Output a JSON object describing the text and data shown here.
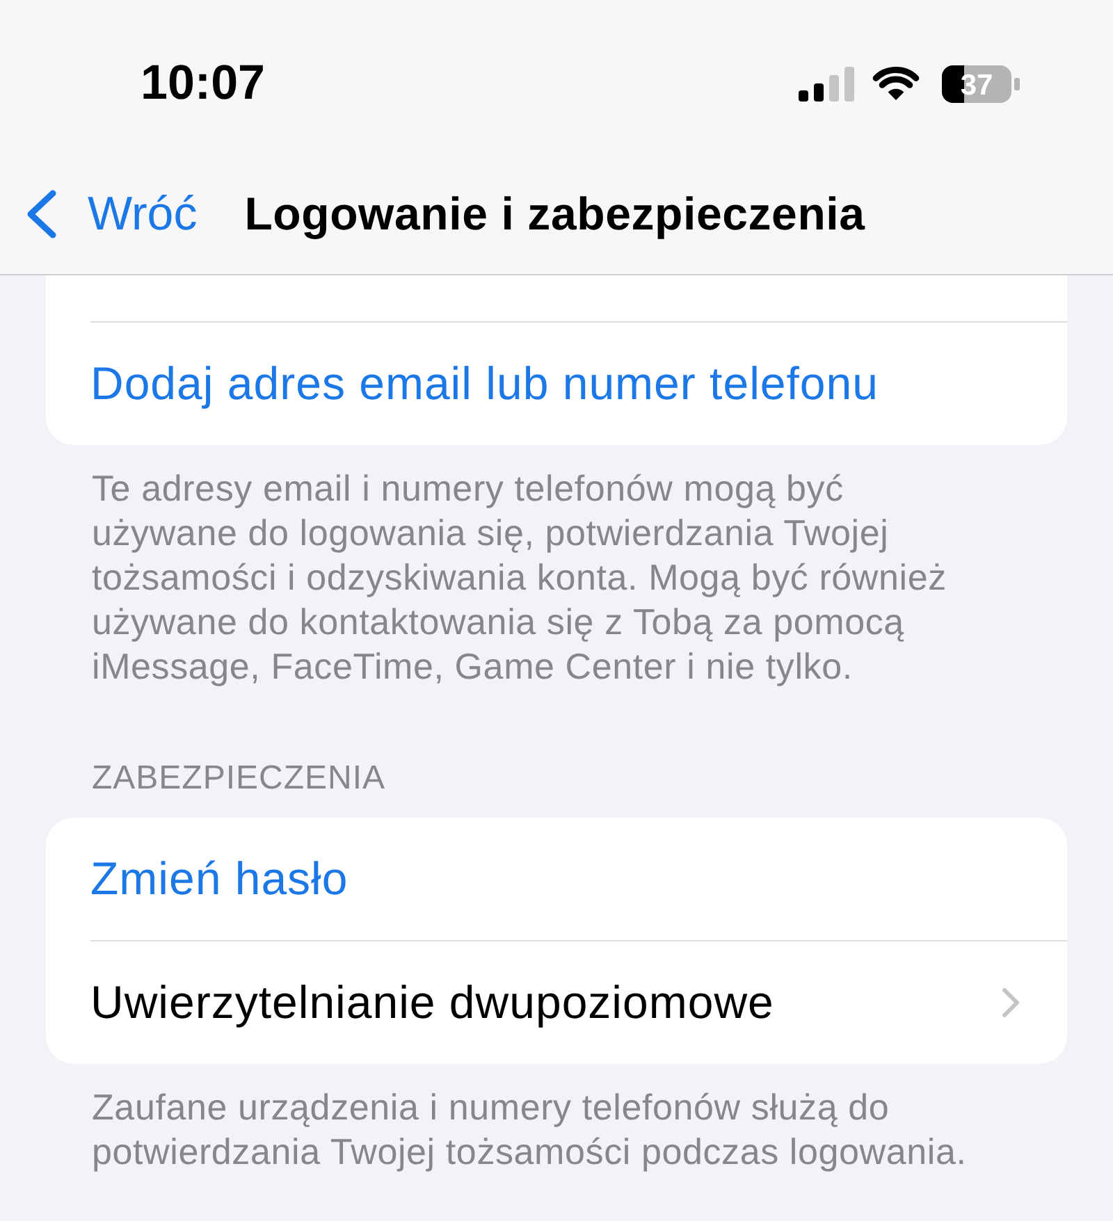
{
  "status_bar": {
    "time": "10:07",
    "battery": "37"
  },
  "nav_bar": {
    "back_label": "Wróć",
    "title": "Logowanie i zabezpieczenia"
  },
  "sections": [
    {
      "clipped": true,
      "rows": [
        {
          "kind": "action",
          "label": "Dodaj adres email lub numer telefonu"
        }
      ],
      "footer": "Te adresy email i numery telefonów mogą być używane do logowania się, potwierdzania Twojej tożsamości i odzyskiwania konta. Mogą być również używane do kontaktowania się z Tobą za pomocą iMessage, FaceTime, Game Center i nie tylko."
    },
    {
      "header": "ZABEZPIECZENIA",
      "clipped": false,
      "rows": [
        {
          "kind": "action",
          "label": "Zmień hasło"
        },
        {
          "kind": "link",
          "label": "Uwierzytelnianie dwupoziomowe"
        }
      ],
      "footer": "Zaufane urządzenia i numery telefonów służą do potwierdzania Twojej tożsamości podczas logowania."
    }
  ]
}
